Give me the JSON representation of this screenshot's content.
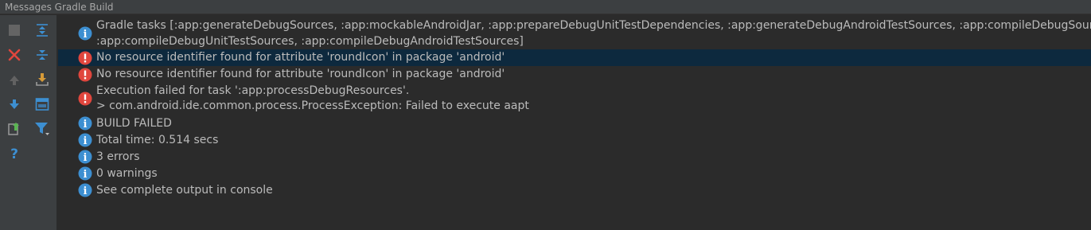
{
  "window": {
    "title": "Messages Gradle Build"
  },
  "toolbar": {
    "buttons": [
      {
        "icon": "stop-icon"
      },
      {
        "icon": "collapse-all-icon"
      },
      {
        "icon": "close-icon"
      },
      {
        "icon": "expand-all-icon"
      },
      {
        "icon": "previous-occurrence-icon"
      },
      {
        "icon": "export-icon"
      },
      {
        "icon": "next-occurrence-icon"
      },
      {
        "icon": "layout-icon"
      },
      {
        "icon": "export-to-file-icon"
      },
      {
        "icon": "filter-icon"
      },
      {
        "icon": "help-icon"
      }
    ]
  },
  "messages": [
    {
      "type": "info",
      "lines": [
        "Gradle tasks [:app:generateDebugSources, :app:mockableAndroidJar, :app:prepareDebugUnitTestDependencies, :app:generateDebugAndroidTestSources, :app:compileDebugSources,",
        ":app:compileDebugUnitTestSources, :app:compileDebugAndroidTestSources]"
      ]
    },
    {
      "type": "error",
      "selected": true,
      "lines": [
        "No resource identifier found for attribute 'roundIcon' in package 'android'"
      ]
    },
    {
      "type": "error",
      "lines": [
        "No resource identifier found for attribute 'roundIcon' in package 'android'"
      ]
    },
    {
      "type": "error",
      "lines": [
        "Execution failed for task ':app:processDebugResources'.",
        "> com.android.ide.common.process.ProcessException: Failed to execute aapt"
      ]
    },
    {
      "type": "info",
      "lines": [
        "BUILD FAILED"
      ]
    },
    {
      "type": "info",
      "lines": [
        "Total time: 0.514 secs"
      ]
    },
    {
      "type": "info",
      "lines": [
        "3 errors"
      ]
    },
    {
      "type": "info",
      "lines": [
        "0 warnings"
      ]
    },
    {
      "type": "info",
      "lines": [
        "See complete output in console"
      ]
    }
  ],
  "colors": {
    "info_icon": "#3d8fd1",
    "error_icon": "#e0463d",
    "selected_row": "#0d293e",
    "text": "#bbbbbb"
  }
}
